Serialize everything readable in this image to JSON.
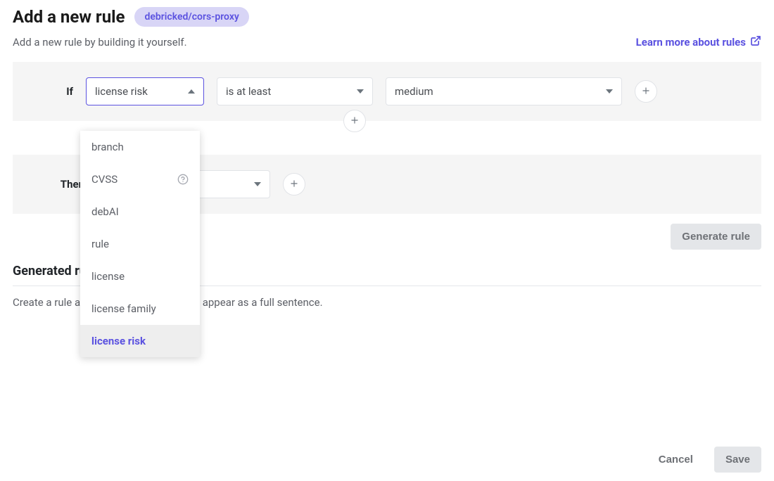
{
  "header": {
    "title": "Add a new rule",
    "repo_badge": "debricked/cors-proxy",
    "subtitle": "Add a new rule by building it yourself.",
    "learn_more": "Learn more about rules"
  },
  "if_row": {
    "label": "If",
    "field_value": "license risk",
    "operator_value": "is at least",
    "threshold_value": "medium"
  },
  "dropdown": {
    "options": [
      {
        "label": "branch",
        "has_help": false,
        "selected": false
      },
      {
        "label": "CVSS",
        "has_help": true,
        "selected": false
      },
      {
        "label": "debAI",
        "has_help": false,
        "selected": false
      },
      {
        "label": "rule",
        "has_help": false,
        "selected": false
      },
      {
        "label": "license",
        "has_help": false,
        "selected": false
      },
      {
        "label": "license family",
        "has_help": false,
        "selected": false
      },
      {
        "label": "license risk",
        "has_help": false,
        "selected": true
      }
    ]
  },
  "then_row": {
    "label": "Then"
  },
  "generate_button": "Generate rule",
  "generated_section": {
    "heading": "Generated rule",
    "description": "Create a rule and click generate to see it appear as a full sentence."
  },
  "footer": {
    "cancel": "Cancel",
    "save": "Save"
  }
}
